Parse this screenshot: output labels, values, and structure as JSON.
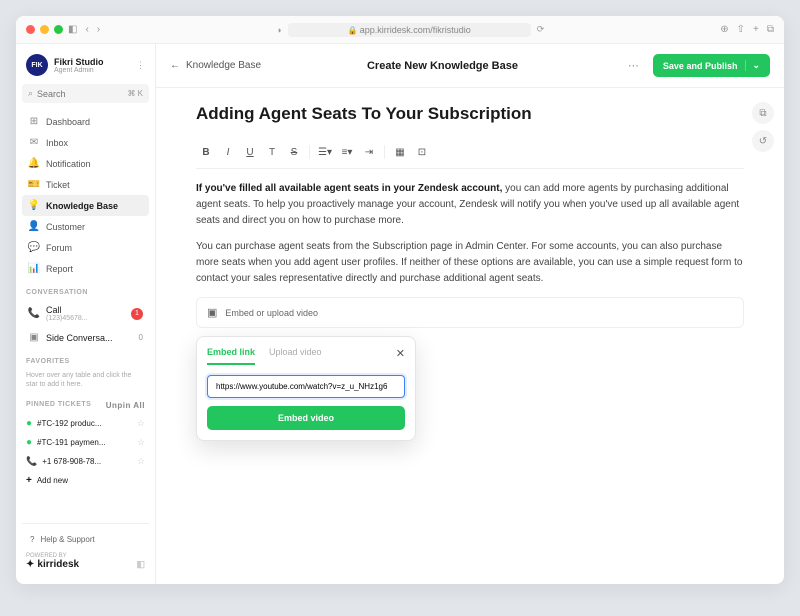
{
  "browser": {
    "url": "app.kirridesk.com/fikristudio"
  },
  "profile": {
    "avatar": "FIK",
    "name": "Fikri Studio",
    "role": "Agent Admin"
  },
  "search": {
    "placeholder": "Search",
    "shortcut": "⌘ K"
  },
  "nav": [
    {
      "icon": "⊞",
      "label": "Dashboard"
    },
    {
      "icon": "✉",
      "label": "Inbox"
    },
    {
      "icon": "🔔",
      "label": "Notification"
    },
    {
      "icon": "🎫",
      "label": "Ticket"
    },
    {
      "icon": "💡",
      "label": "Knowledge Base",
      "active": true
    },
    {
      "icon": "👤",
      "label": "Customer"
    },
    {
      "icon": "💬",
      "label": "Forum"
    },
    {
      "icon": "📊",
      "label": "Report"
    }
  ],
  "sections": {
    "conversation": "CONVERSATION",
    "favorites": "FAVORITES",
    "pinned": "PINNED TICKETS"
  },
  "conversation": [
    {
      "icon": "📞",
      "label": "Call",
      "sub": "(123)45678...",
      "badge": "1"
    },
    {
      "icon": "▣",
      "label": "Side Conversa...",
      "count": "0"
    }
  ],
  "favorites_hint": "Hover over any table and click the star to add it here.",
  "unpin": "Unpin All",
  "pinned": [
    {
      "icon": "wa",
      "label": "#TC-192 produc..."
    },
    {
      "icon": "wa",
      "label": "#TC-191 paymen..."
    },
    {
      "icon": "phone",
      "label": "+1 678-908-78..."
    },
    {
      "icon": "plus",
      "label": "Add new"
    }
  ],
  "help": "Help & Support",
  "powered": "POWERED BY",
  "brand": "kirridesk",
  "topbar": {
    "back": "Knowledge Base",
    "title": "Create New Knowledge Base",
    "save": "Save and Publish"
  },
  "article": {
    "title": "Adding Agent Seats To Your Subscription",
    "p1_bold": "If you've filled all available agent seats in your Zendesk account,",
    "p1_rest": " you can add more agents by purchasing additional agent seats. To help you proactively manage your account, Zendesk will notify you when you've used up all available agent seats and direct you on how to purchase more.",
    "p2": "You can purchase agent seats from the Subscription page in Admin Center. For some accounts, you can also purchase more seats when you add agent user profiles. If neither of these options are available, you can use a simple request form to contact your sales representative directly and purchase additional agent seats.",
    "embed_placeholder": "Embed or upload video"
  },
  "popup": {
    "tab_embed": "Embed link",
    "tab_upload": "Upload video",
    "url": "https://www.youtube.com/watch?v=z_u_NHz1g6",
    "button": "Embed video"
  }
}
